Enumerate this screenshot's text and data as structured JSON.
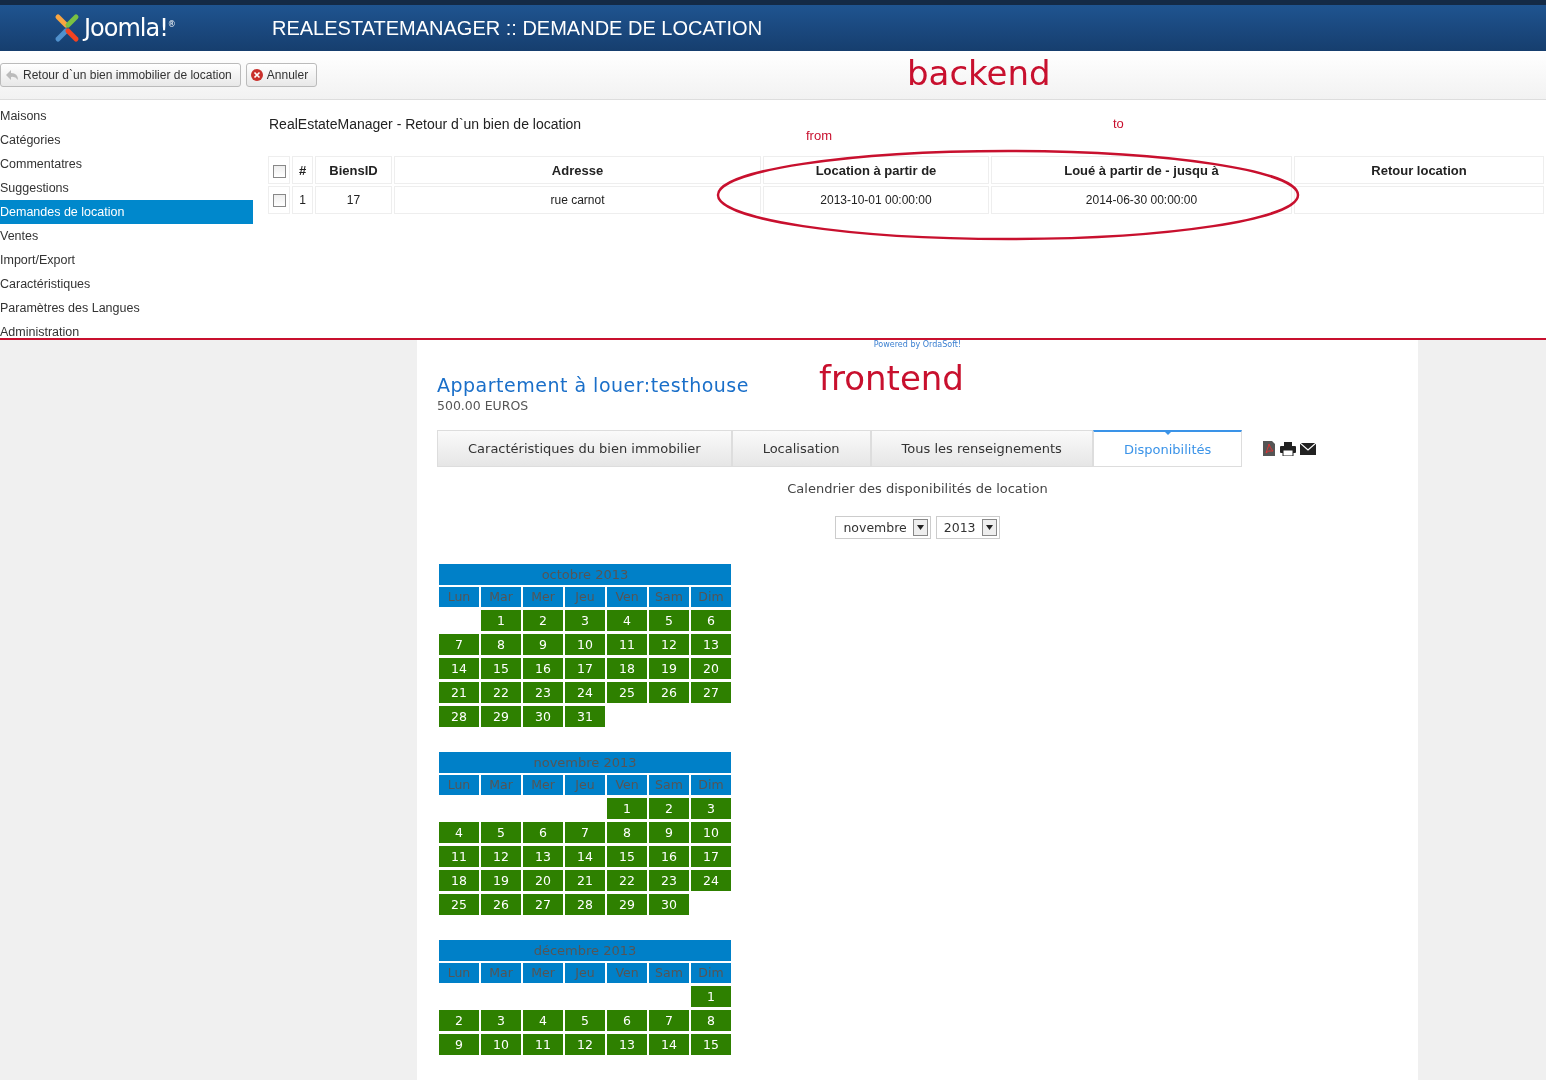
{
  "header": {
    "brand": "Joomla!$^{®}$",
    "title": "REALESTATEMANAGER :: DEMANDE DE LOCATION"
  },
  "toolbar": {
    "buttons": [
      {
        "kind": "return",
        "label": "Retour d`un bien immobilier de location"
      },
      {
        "kind": "cancel",
        "label": "Annuler"
      }
    ]
  },
  "annotations": {
    "backend": "backend",
    "frontend": "frontend",
    "from": "from",
    "to": "to"
  },
  "sidebar": {
    "items": [
      {
        "label": "Maisons",
        "selected": false
      },
      {
        "label": "Catégories",
        "selected": false
      },
      {
        "label": "Commentatres",
        "selected": false
      },
      {
        "label": "Suggestions",
        "selected": false
      },
      {
        "label": "Demandes de location",
        "selected": true
      },
      {
        "label": "Ventes",
        "selected": false
      },
      {
        "label": "Import/Export",
        "selected": false
      },
      {
        "label": "Caractéristiques",
        "selected": false
      },
      {
        "label": "Paramètres des Langues",
        "selected": false
      },
      {
        "label": "Administration",
        "selected": false
      }
    ]
  },
  "backend": {
    "heading": "RealEstateManager - Retour d`un bien de location",
    "table": {
      "select_all": {
        "checked": false
      },
      "columns": [
        "#",
        "BiensID",
        "Adresse",
        "Location à partir de",
        "Loué à partir de - jusqu à",
        "Retour location"
      ],
      "rows": [
        {
          "checked": false,
          "number": "1",
          "biens_id": "17",
          "adresse": "rue carnot",
          "from": "2013-10-01 00:00:00",
          "to": "2014-06-30 00:00:00"
        }
      ]
    }
  },
  "frontend": {
    "powered_by": "Powered by OrdaSoft!",
    "title": "Appartement à louer:testhouse",
    "price": "500.00 EUROS",
    "tabs": [
      {
        "label": "Caractéristiques du bien immobilier",
        "selected": false
      },
      {
        "label": "Localisation",
        "selected": false
      },
      {
        "label": "Tous les renseignements",
        "selected": false
      },
      {
        "label": "Disponibilités",
        "selected": true
      }
    ],
    "calendar_heading": "Calendrier des disponibilités de location",
    "month_select": "novembre",
    "year_select": "2013",
    "calendars": [
      {
        "title": "octobre 2013",
        "weekdays": [
          "Lun",
          "Mar",
          "Mer",
          "Jeu",
          "Ven",
          "Sam",
          "Dim"
        ],
        "weeks": [
          [
            {
              "kind": "blank"
            },
            {
              "kind": "day",
              "label": "1"
            },
            {
              "kind": "day",
              "label": "2"
            },
            {
              "kind": "day",
              "label": "3"
            },
            {
              "kind": "day",
              "label": "4"
            },
            {
              "kind": "day",
              "label": "5"
            },
            {
              "kind": "day",
              "label": "6"
            }
          ],
          [
            {
              "kind": "day",
              "label": "7"
            },
            {
              "kind": "day",
              "label": "8"
            },
            {
              "kind": "day",
              "label": "9"
            },
            {
              "kind": "day",
              "label": "10"
            },
            {
              "kind": "day",
              "label": "11"
            },
            {
              "kind": "day",
              "label": "12"
            },
            {
              "kind": "day",
              "label": "13"
            }
          ],
          [
            {
              "kind": "day",
              "label": "14"
            },
            {
              "kind": "day",
              "label": "15"
            },
            {
              "kind": "day",
              "label": "16"
            },
            {
              "kind": "day",
              "label": "17"
            },
            {
              "kind": "day",
              "label": "18"
            },
            {
              "kind": "day",
              "label": "19"
            },
            {
              "kind": "day",
              "label": "20"
            }
          ],
          [
            {
              "kind": "day",
              "label": "21"
            },
            {
              "kind": "day",
              "label": "22"
            },
            {
              "kind": "day",
              "label": "23"
            },
            {
              "kind": "day",
              "label": "24"
            },
            {
              "kind": "day",
              "label": "25"
            },
            {
              "kind": "day",
              "label": "26"
            },
            {
              "kind": "day",
              "label": "27"
            }
          ],
          [
            {
              "kind": "day",
              "label": "28"
            },
            {
              "kind": "day",
              "label": "29"
            },
            {
              "kind": "day",
              "label": "30"
            },
            {
              "kind": "day",
              "label": "31"
            }
          ]
        ]
      },
      {
        "title": "novembre 2013",
        "weekdays": [
          "Lun",
          "Mar",
          "Mer",
          "Jeu",
          "Ven",
          "Sam",
          "Dim"
        ],
        "weeks": [
          [
            {
              "kind": "blank"
            },
            {
              "kind": "blank"
            },
            {
              "kind": "blank"
            },
            {
              "kind": "blank"
            },
            {
              "kind": "day",
              "label": "1"
            },
            {
              "kind": "day",
              "label": "2"
            },
            {
              "kind": "day",
              "label": "3"
            }
          ],
          [
            {
              "kind": "day",
              "label": "4"
            },
            {
              "kind": "day",
              "label": "5"
            },
            {
              "kind": "day",
              "label": "6"
            },
            {
              "kind": "day",
              "label": "7"
            },
            {
              "kind": "day",
              "label": "8"
            },
            {
              "kind": "day",
              "label": "9"
            },
            {
              "kind": "day",
              "label": "10"
            }
          ],
          [
            {
              "kind": "day",
              "label": "11"
            },
            {
              "kind": "day",
              "label": "12"
            },
            {
              "kind": "day",
              "label": "13"
            },
            {
              "kind": "day",
              "label": "14"
            },
            {
              "kind": "day",
              "label": "15"
            },
            {
              "kind": "day",
              "label": "16"
            },
            {
              "kind": "day",
              "label": "17"
            }
          ],
          [
            {
              "kind": "day",
              "label": "18"
            },
            {
              "kind": "day",
              "label": "19"
            },
            {
              "kind": "day",
              "label": "20"
            },
            {
              "kind": "day",
              "label": "21"
            },
            {
              "kind": "day",
              "label": "22"
            },
            {
              "kind": "day",
              "label": "23"
            },
            {
              "kind": "day",
              "label": "24"
            }
          ],
          [
            {
              "kind": "day",
              "label": "25"
            },
            {
              "kind": "day",
              "label": "26"
            },
            {
              "kind": "day",
              "label": "27"
            },
            {
              "kind": "day",
              "label": "28"
            },
            {
              "kind": "day",
              "label": "29"
            },
            {
              "kind": "day",
              "label": "30"
            }
          ]
        ]
      },
      {
        "title": "décembre 2013",
        "weekdays": [
          "Lun",
          "Mar",
          "Mer",
          "Jeu",
          "Ven",
          "Sam",
          "Dim"
        ],
        "weeks": [
          [
            {
              "kind": "blank"
            },
            {
              "kind": "blank"
            },
            {
              "kind": "blank"
            },
            {
              "kind": "blank"
            },
            {
              "kind": "blank"
            },
            {
              "kind": "blank"
            },
            {
              "kind": "day",
              "label": "1"
            }
          ],
          [
            {
              "kind": "day",
              "label": "2"
            },
            {
              "kind": "day",
              "label": "3"
            },
            {
              "kind": "day",
              "label": "4"
            },
            {
              "kind": "day",
              "label": "5"
            },
            {
              "kind": "day",
              "label": "6"
            },
            {
              "kind": "day",
              "label": "7"
            },
            {
              "kind": "day",
              "label": "8"
            }
          ],
          [
            {
              "kind": "day",
              "label": "9"
            },
            {
              "kind": "day",
              "label": "10"
            },
            {
              "kind": "day",
              "label": "11"
            },
            {
              "kind": "day",
              "label": "12"
            },
            {
              "kind": "day",
              "label": "13"
            },
            {
              "kind": "day",
              "label": "14"
            },
            {
              "kind": "day",
              "label": "15"
            }
          ]
        ]
      }
    ]
  }
}
